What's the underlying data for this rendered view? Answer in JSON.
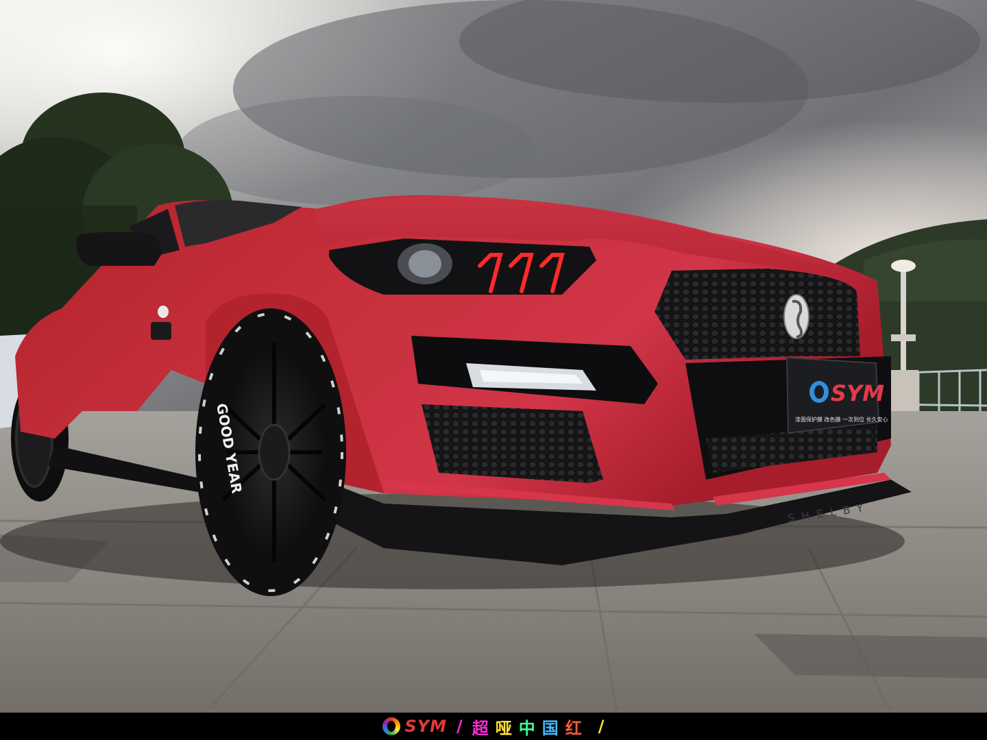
{
  "photo": {
    "subject": "matte red Ford Mustang with Shelby-style body kit, low front three-quarter view",
    "colors": {
      "body_red": "#c4283a",
      "sky": "#8f9196",
      "ground": "#8a8680"
    }
  },
  "plate": {
    "brand": "SYM",
    "caption": "漆面保护膜 改色膜 一次到位 长久安心"
  },
  "tire_lettering": "GOOD YEAR",
  "splitter_lettering": "SHELBY",
  "bottom_bar": {
    "logo_text": "SYM",
    "separator_left": "/",
    "slogan": "超哑中国红",
    "separator_right": "/"
  }
}
